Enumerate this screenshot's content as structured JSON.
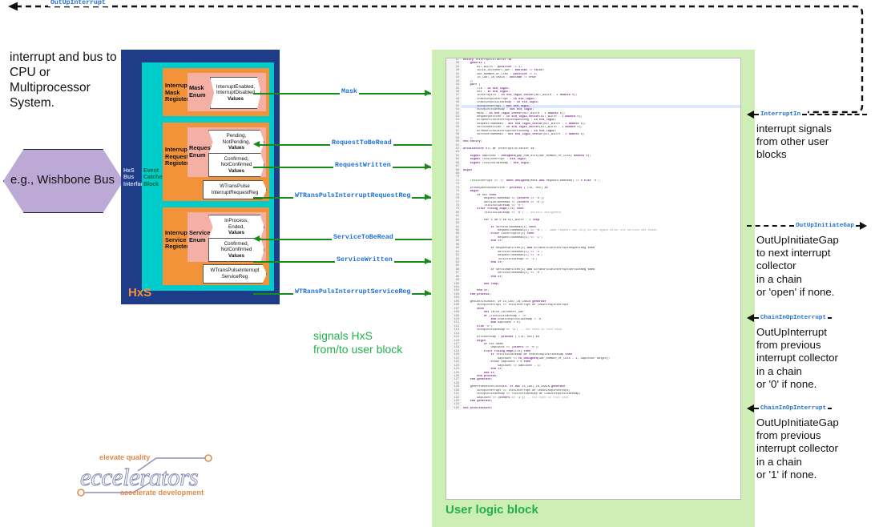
{
  "left_note": "interrupt and bus to CPU or Multiprocessor System.",
  "bus": {
    "label": "e.g., Wishbone Bus"
  },
  "hxs": {
    "title": "HxS",
    "bus_interface_label": "HxS Bus Interface",
    "event_catcher_label": "Event Catcher Block",
    "registers": [
      {
        "name": "Interrupt Mask Register",
        "enum_label": "Mask Enum",
        "values": [
          "InterruptEnabled,",
          "InterruptDisabled",
          "Values"
        ]
      },
      {
        "name": "Interrupt Request Register",
        "enum_label": "Request Enum",
        "values_a": [
          "Pending,",
          "NotPending,",
          "Values"
        ],
        "values_b": [
          "Confirmed,",
          "NotConfirmed",
          "Values"
        ],
        "pulse": [
          "WTransPulse",
          "InterruptRequestReg"
        ]
      },
      {
        "name": "Interrupt Service Register",
        "enum_label": "Service Enum",
        "values_a": [
          "InProcess,",
          "Ended,",
          "Values"
        ],
        "values_b": [
          "Confirmed,",
          "NotConfirmed",
          "Values"
        ],
        "pulse": [
          "WTransPulseInterrupt",
          "ServiceReg"
        ]
      }
    ]
  },
  "signals": [
    {
      "name": "Mask",
      "dir": "right"
    },
    {
      "name": "RequestToBeRead",
      "dir": "left"
    },
    {
      "name": "RequestWritten",
      "dir": "right"
    },
    {
      "name": "WTRansPulsInterruptRequestReg",
      "dir": "right"
    },
    {
      "name": "ServiceToBeRead",
      "dir": "left"
    },
    {
      "name": "ServiceWritten",
      "dir": "right"
    },
    {
      "name": "WTRansPulsInterruptServiceReg",
      "dir": "right"
    }
  ],
  "signals_note": "signals HxS\nfrom/to user block",
  "top_feedback": {
    "name": "OutUpInterrupt"
  },
  "user_block": {
    "label": "User logic block"
  },
  "right_annotations": [
    {
      "signal": "InterruptIn",
      "dir": "left",
      "text": "interrupt signals\nfrom other user\nblocks"
    },
    {
      "signal": "OutUpInitiateGap",
      "dir": "right",
      "text": "OutUpInitiateGap\nto next interrupt\ncollector\nin a chain\nor 'open' if none."
    },
    {
      "signal": "ChainInOpInterrupt",
      "dir": "left",
      "text": "OutUpInterrupt\nfrom previous\ninterrupt collector\nin a chain\nor '0' if none."
    },
    {
      "signal": "ChainInOpInterrupt",
      "dir": "left",
      "text": "OutUpInitiateGap\nfrom previous\ninterrupt collector\nin a chain\nor '1' if none."
    }
  ],
  "logo": {
    "tagline_top": "elevate quality",
    "word": "eccelerators",
    "tagline_bottom": "accelerate development"
  },
  "colors": {
    "hxs_outer": "#1f3c88",
    "hxs_cyan": "#00cccc",
    "register": "#f29339",
    "register_inner": "#f4b0a4",
    "signal_green": "#1a8a1a",
    "signal_text": "#1f6fd0",
    "user_block": "#cdeeb4",
    "user_block_label": "#22b14c",
    "bus": "#bda9d6"
  },
  "code": {
    "language": "VHDL",
    "first_line_number": 37,
    "highlighted_line": 50,
    "lines": [
      {
        "n": 37,
        "t": "entity InterruptCollector is"
      },
      {
        "n": 38,
        "t": "    generic ("
      },
      {
        "n": 39,
        "t": "        BIT_WIDTH : positive := 1;"
      },
      {
        "n": 40,
        "t": "        INTER_INTERRUPT_GAP : boolean := false;"
      },
      {
        "n": 41,
        "t": "        GAP_NUMBER_OF_CLKS : positive := 1;"
      },
      {
        "n": 42,
        "t": "        IS_LAST_IN_CHAIN : boolean := true"
      },
      {
        "n": 43,
        "t": "    );"
      },
      {
        "n": 44,
        "t": "    port ("
      },
      {
        "n": 45,
        "t": "        Clk : in std_logic;"
      },
      {
        "n": 46,
        "t": "        Rst : in std_logic;"
      },
      {
        "n": 47,
        "t": "        InterruptIn : in std_logic_vector(BIT_WIDTH - 1 downto 0);"
      },
      {
        "n": 48,
        "t": "        ChainInUpInterrupt : in std_logic;"
      },
      {
        "n": 49,
        "t": "        ChainInUpInitiateGap : in std_logic;"
      },
      {
        "n": 50,
        "t": "        OutUpInterrupt : out std_logic;"
      },
      {
        "n": 51,
        "t": "        OutUpInitiateGap : out std_logic;"
      },
      {
        "n": 52,
        "t": "        Mask : in std_logic_vector(BIT_WIDTH - 1 downto 0);"
      },
      {
        "n": 53,
        "t": "        RequestWritten : in std_logic_vector(BIT_WIDTH - 1 downto 0);"
      },
      {
        "n": 54,
        "t": "        WTransPulseInterruptRequestReg : in std_logic;"
      },
      {
        "n": 55,
        "t": "        RequestToBeRead : out std_logic_vector(BIT_WIDTH - 1 downto 0);"
      },
      {
        "n": 56,
        "t": "        ServiceWritten : in std_logic_vector(BIT_WIDTH - 1 downto 0);"
      },
      {
        "n": 57,
        "t": "        WTransPulseInterruptServiceReg : in std_logic;"
      },
      {
        "n": 58,
        "t": "        ServiceToBeRead : out std_logic_vector(BIT_WIDTH - 1 downto 0)"
      },
      {
        "n": 59,
        "t": "    );"
      },
      {
        "n": 60,
        "t": "end entity;"
      },
      {
        "n": 61,
        "t": ""
      },
      {
        "n": 62,
        "t": "architecture RTL of InterruptCollector is"
      },
      {
        "n": 63,
        "t": ""
      },
      {
        "n": 64,
        "t": "    signal GapCount : unsigned(gap_num_bits(GAP_NUMBER_OF_CLKS) downto 0);"
      },
      {
        "n": 65,
        "t": "    signal ThisInterrupt : std_logic;"
      },
      {
        "n": 66,
        "t": "    signal ThisInitiateGap : std_logic;"
      },
      {
        "n": 67,
        "t": ""
      },
      {
        "n": 68,
        "t": "begin"
      },
      {
        "n": 69,
        "t": ""
      },
      {
        "n": 70,
        "t": ""
      },
      {
        "n": 71,
        "t": "    ThisInterrupt <= '1' when unsigned(Mask and RequestToBeRead) /= 0 else '0';"
      },
      {
        "n": 72,
        "t": ""
      },
      {
        "n": 73,
        "t": "    prcRequestAndService : process ( Clk, Rst) is"
      },
      {
        "n": 74,
        "t": "    begin"
      },
      {
        "n": 75,
        "t": "        if Rst then"
      },
      {
        "n": 76,
        "t": "            RequestToBeRead <= (others => '0');"
      },
      {
        "n": 77,
        "t": "            ServiceToBeRead <= (others => '0');"
      },
      {
        "n": 78,
        "t": "            ThisInitiateGap <= '0';"
      },
      {
        "n": 79,
        "t": "        elsif rising_edge(Clk) then"
      },
      {
        "n": 80,
        "t": "            ThisInitiateGap <= '0'; -- default assignment"
      },
      {
        "n": 81,
        "t": ""
      },
      {
        "n": 82,
        "t": "            for i in 0 to BIT_WIDTH - 1 loop"
      },
      {
        "n": 83,
        "t": ""
      },
      {
        "n": 84,
        "t": "                if ServiceToBeRead(i) then"
      },
      {
        "n": 85,
        "t": "                    RequestToBeRead(i) <= '0'; -- same request can only be set again after its service has ended"
      },
      {
        "n": 86,
        "t": "                elsif InterruptIn(i) then"
      },
      {
        "n": 87,
        "t": "                    RequestToBeRead(i) <= '1';"
      },
      {
        "n": 88,
        "t": "                end if;"
      },
      {
        "n": 89,
        "t": ""
      },
      {
        "n": 90,
        "t": "                if RequestWritten(i) and wTransPulseInterruptRequestReg then"
      },
      {
        "n": 91,
        "t": "                    ServiceToBeRead(i) <= '1';"
      },
      {
        "n": 92,
        "t": "                    RequestToBeRead(i) <= '0';"
      },
      {
        "n": 93,
        "t": "                    ThisInitiateGap <= '1';"
      },
      {
        "n": 94,
        "t": "                end if;"
      },
      {
        "n": 95,
        "t": ""
      },
      {
        "n": 96,
        "t": "                if ServiceWritten(i) and wTransPulseInterruptServiceReg then"
      },
      {
        "n": 97,
        "t": "                    ServiceToBeRead(i) <= '0';"
      },
      {
        "n": 98,
        "t": "                end if;"
      },
      {
        "n": 99,
        "t": ""
      },
      {
        "n": 100,
        "t": "            end loop;"
      },
      {
        "n": 101,
        "t": ""
      },
      {
        "n": 102,
        "t": "        end if;"
      },
      {
        "n": 103,
        "t": "    end process;"
      },
      {
        "n": 104,
        "t": ""
      },
      {
        "n": 105,
        "t": "    genLastInChain: if IS_LAST_IN_CHAIN generate"
      },
      {
        "n": 106,
        "t": "        OutUpInterrupt <= ThisInterrupt or ChainInUpInterrupt"
      },
      {
        "n": 107,
        "t": "        when"
      },
      {
        "n": 108,
        "t": "            not INTER_INTERRUPT_GAP"
      },
      {
        "n": 109,
        "t": "            or (ThisInitiateGap = '0'"
      },
      {
        "n": 110,
        "t": "                and ChainInUpInitiateGap = '0'"
      },
      {
        "n": 111,
        "t": "                and GapCount = 0)"
      },
      {
        "n": 112,
        "t": "        else '0';"
      },
      {
        "n": 113,
        "t": "        OutUpInitiateGap <= '1'; -- not used in this case"
      },
      {
        "n": 114,
        "t": ""
      },
      {
        "n": 115,
        "t": "        prcCountGap : process ( Clk, Rst) is"
      },
      {
        "n": 116,
        "t": "        begin"
      },
      {
        "n": 117,
        "t": "            if Rst then"
      },
      {
        "n": 118,
        "t": "                GapCount <= (others => '0');"
      },
      {
        "n": 119,
        "t": "            elsif rising_edge(Clk) then"
      },
      {
        "n": 120,
        "t": "                if ThisInitiateGap or ChainInUpInitiateGap then"
      },
      {
        "n": 121,
        "t": "                    GapCount <= to_unsigned(GAP_NUMBER_OF_CLKS - 1, GapCount'length);"
      },
      {
        "n": 122,
        "t": "                elsif GapCount > 0 then"
      },
      {
        "n": 123,
        "t": "                    GapCount <= GapCount - 1;"
      },
      {
        "n": 124,
        "t": "                end if;"
      },
      {
        "n": 125,
        "t": "            end if;"
      },
      {
        "n": 126,
        "t": "        end process;"
      },
      {
        "n": 127,
        "t": "    end generate;"
      },
      {
        "n": 128,
        "t": ""
      },
      {
        "n": 129,
        "t": "    genPredecessorInChain: if not IS_LAST_IN_CHAIN generate"
      },
      {
        "n": 130,
        "t": "        OutUpInterrupt <= ThisInterrupt or ChainInUpInterrupt;"
      },
      {
        "n": 131,
        "t": "        OutUpInitiateGap <= ThisInitiateGap or ChainInUpInitiateGap;"
      },
      {
        "n": 132,
        "t": "        GapCount <= (others => '1'); -- not used in this case"
      },
      {
        "n": 133,
        "t": "    end generate;"
      },
      {
        "n": 134,
        "t": ""
      },
      {
        "n": 135,
        "t": "end architecture;"
      }
    ]
  }
}
